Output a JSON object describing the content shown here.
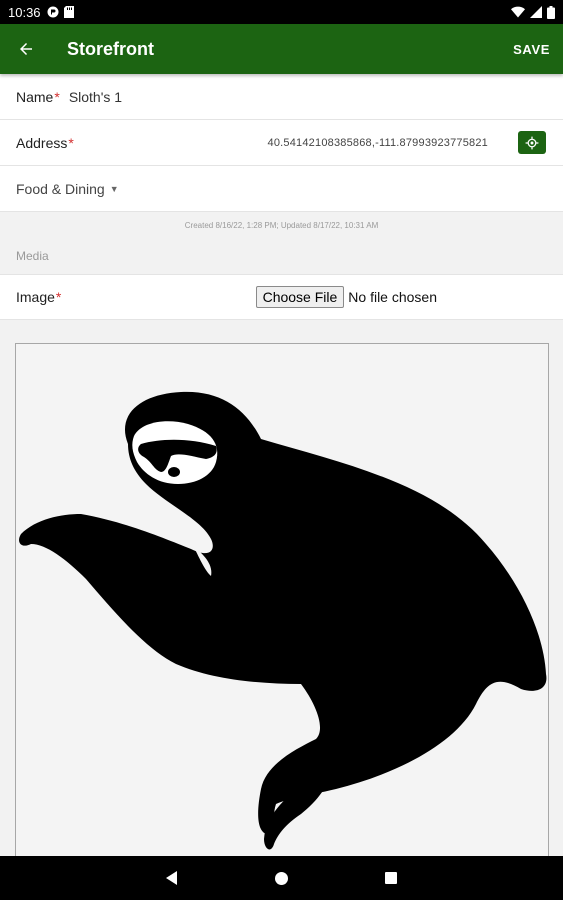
{
  "status_bar": {
    "time": "10:36",
    "left_icons": [
      "notification-icon",
      "sd-card-icon"
    ],
    "right_icons": [
      "wifi-icon",
      "signal-icon",
      "battery-icon"
    ]
  },
  "app_bar": {
    "title": "Storefront",
    "save_label": "SAVE",
    "background": "#1c6412"
  },
  "form": {
    "name": {
      "label": "Name",
      "value": "Sloth's 1",
      "required": true
    },
    "address": {
      "label": "Address",
      "value": "40.54142108385868,-111.87993923775821",
      "required": true
    },
    "category": {
      "value": "Food & Dining"
    },
    "meta": "Created 8/16/22, 1:28 PM; Updated 8/17/22, 10:31 AM",
    "media_section": "Media",
    "image": {
      "label": "Image",
      "required": true,
      "button_label": "Choose File",
      "file_status": "No file chosen"
    },
    "required_marker": "*"
  },
  "preview": {
    "description_icon": "sloth-image"
  },
  "nav_bar": {
    "icons": [
      "back-nav-icon",
      "home-nav-icon",
      "recents-nav-icon"
    ]
  }
}
